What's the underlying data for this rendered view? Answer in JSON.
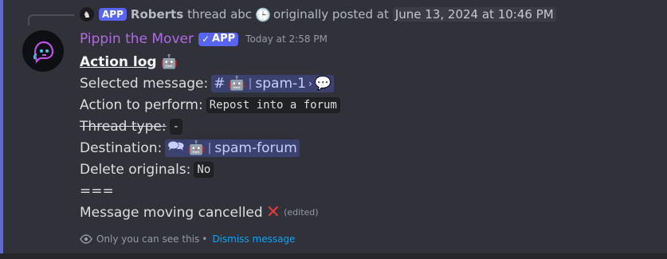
{
  "colors": {
    "accent": "#5865f2",
    "bot_name": "#b06be3",
    "link": "#00a8fc",
    "cancel": "#e03b3b"
  },
  "reply": {
    "badge": "APP",
    "author": "Roberts",
    "text": "thread abc",
    "clock_icon": "clock-icon",
    "label": "originally posted at",
    "timestamp": "June 13, 2024 at 10:46 PM"
  },
  "message": {
    "author": "Pippin the Mover",
    "badge": "APP",
    "badge_check": "✓",
    "time": "Today at 2:58 PM",
    "title": "Action log",
    "title_emoji": "robot-face",
    "fields": {
      "selected_label": "Selected message:",
      "selected_channel_icon": "hash-icon",
      "selected_bot_icon": "robot-icon",
      "selected_channel": "spam-1",
      "selected_thread_icon": "speech-bubble-icon",
      "action_label": "Action to perform:",
      "action_value": "Repost into a forum",
      "thread_type_label": "Thread type:",
      "thread_type_value": "-",
      "destination_label": "Destination:",
      "destination_icon": "forum-icon",
      "destination_channel": "spam-forum",
      "delete_label": "Delete originals:",
      "delete_value": "No"
    },
    "separator": "===",
    "status": "Message moving cancelled",
    "status_icon": "cross-mark-icon",
    "edited": "(edited)"
  },
  "footer": {
    "text": "Only you can see this",
    "bullet": "•",
    "dismiss": "Dismiss message"
  }
}
